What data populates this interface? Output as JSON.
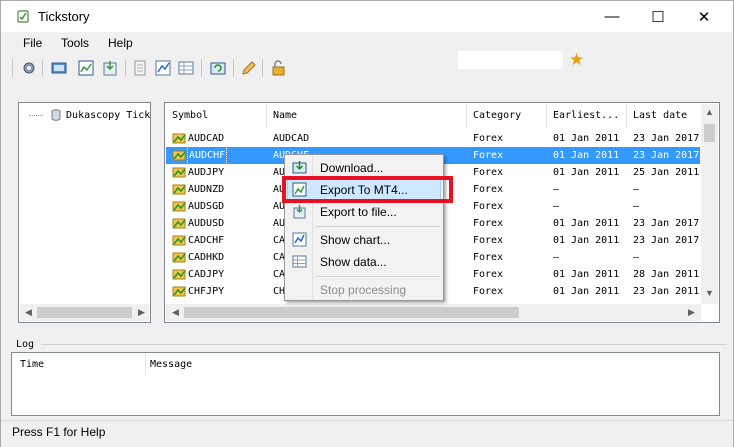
{
  "window": {
    "title": "Tickstory",
    "minimize_glyph": "—",
    "maximize_glyph": "☐",
    "close_glyph": "✕"
  },
  "menu": [
    "File",
    "Tools",
    "Help"
  ],
  "toolbar": {
    "icons": [
      "gear-icon",
      "connect-icon",
      "export-mt4-icon",
      "export-file-icon",
      "document-icon",
      "chart-icon",
      "data-icon",
      "refresh-icon",
      "edit-icon",
      "lock-icon"
    ],
    "favorite_glyph": "★"
  },
  "tree": {
    "root_label": "Dukascopy Tick"
  },
  "grid": {
    "columns": [
      "Symbol",
      "Name",
      "Category",
      "Earliest...",
      "Last date"
    ],
    "rows": [
      {
        "symbol": "AUDCAD",
        "name": "AUDCAD",
        "category": "Forex",
        "earliest": "01 Jan 2011",
        "last": "23 Jan 2017",
        "selected": false
      },
      {
        "symbol": "AUDCHF",
        "name": "AUDCHF",
        "category": "Forex",
        "earliest": "01 Jan 2011",
        "last": "23 Jan 2017",
        "selected": true
      },
      {
        "symbol": "AUDJPY",
        "name": "AUDJPY",
        "category": "Forex",
        "earliest": "01 Jan 2011",
        "last": "25 Jan 2011",
        "selected": false
      },
      {
        "symbol": "AUDNZD",
        "name": "AUDNZD",
        "category": "Forex",
        "earliest": "–",
        "last": "–",
        "selected": false
      },
      {
        "symbol": "AUDSGD",
        "name": "AUDSGD",
        "category": "Forex",
        "earliest": "–",
        "last": "–",
        "selected": false
      },
      {
        "symbol": "AUDUSD",
        "name": "AUDUSD",
        "category": "Forex",
        "earliest": "01 Jan 2011",
        "last": "23 Jan 2017",
        "selected": false
      },
      {
        "symbol": "CADCHF",
        "name": "CADCHF",
        "category": "Forex",
        "earliest": "01 Jan 2011",
        "last": "23 Jan 2017",
        "selected": false
      },
      {
        "symbol": "CADHKD",
        "name": "CADHKD",
        "category": "Forex",
        "earliest": "–",
        "last": "–",
        "selected": false
      },
      {
        "symbol": "CADJPY",
        "name": "CADJPY",
        "category": "Forex",
        "earliest": "01 Jan 2011",
        "last": "28 Jan 2011",
        "selected": false
      },
      {
        "symbol": "CHFJPY",
        "name": "CHFJPY",
        "category": "Forex",
        "earliest": "01 Jan 2011",
        "last": "23 Jan 2011",
        "selected": false
      }
    ]
  },
  "context_menu": {
    "items": [
      {
        "label": "Download...",
        "icon": "download-icon",
        "enabled": true,
        "highlighted": false
      },
      {
        "label": "Export To MT4...",
        "icon": "export-mt4-icon",
        "enabled": true,
        "highlighted": true
      },
      {
        "label": "Export to file...",
        "icon": "export-file-icon",
        "enabled": true,
        "highlighted": false
      },
      {
        "label": "Show chart...",
        "icon": "chart-icon",
        "enabled": true,
        "highlighted": false
      },
      {
        "label": "Show data...",
        "icon": "data-icon",
        "enabled": true,
        "highlighted": false
      },
      {
        "label": "Stop processing",
        "icon": "",
        "enabled": false,
        "highlighted": false
      }
    ]
  },
  "log": {
    "title": "Log",
    "columns": [
      "Time",
      "Message"
    ]
  },
  "status": {
    "text": "Press F1 for Help"
  },
  "colors": {
    "selection": "#3399ff",
    "menu_highlight": "#cde8ff",
    "annotation_red": "#e81123",
    "star": "#f0a000"
  }
}
